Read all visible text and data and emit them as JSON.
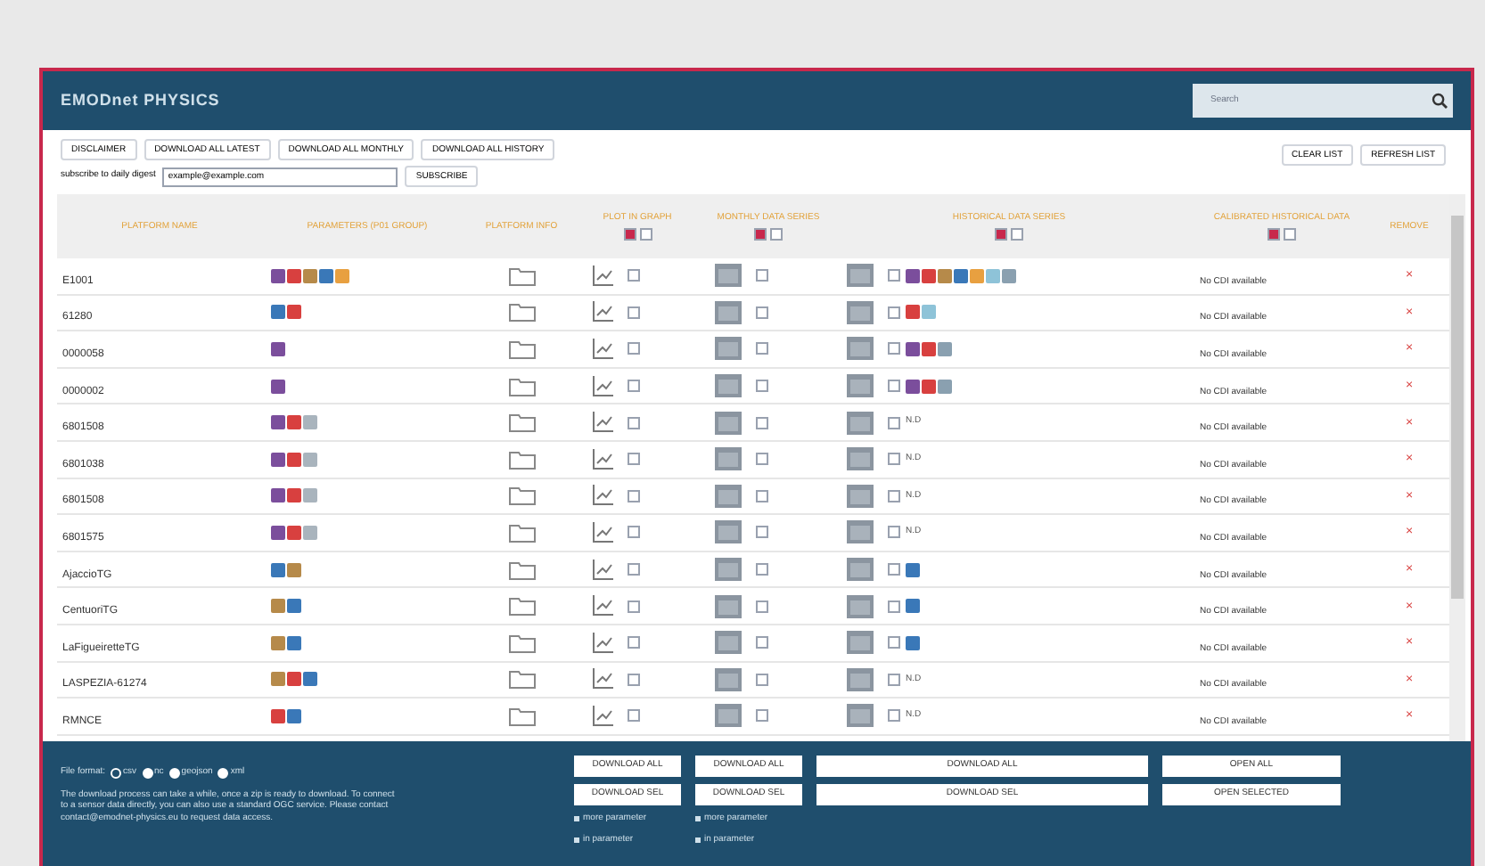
{
  "header": {
    "title": "EMODnet PHYSICS",
    "search": {
      "placeholder": "Search"
    }
  },
  "toolbar": {
    "buttons": [
      "DISCLAIMER",
      "DOWNLOAD ALL LATEST",
      "DOWNLOAD ALL MONTHLY",
      "DOWNLOAD ALL HISTORY"
    ],
    "right_buttons": [
      "CLEAR LIST",
      "REFRESH LIST"
    ],
    "subscribe": {
      "label": "subscribe to daily digest",
      "value": "example@example.com",
      "button": "SUBSCRIBE"
    }
  },
  "columns": [
    {
      "label": "PLATFORM NAME"
    },
    {
      "label": "PARAMETERS (P01 GROUP)"
    },
    {
      "label": "PLATFORM INFO"
    },
    {
      "label": "PLOT IN GRAPH",
      "toggles": [
        {
          "checked": true
        },
        {
          "checked": false
        }
      ]
    },
    {
      "label": "MONTHLY DATA SERIES",
      "toggles": [
        {
          "checked": true
        },
        {
          "checked": false
        }
      ]
    },
    {
      "label": "HISTORICAL DATA SERIES",
      "toggles": [
        {
          "checked": true
        },
        {
          "checked": false
        }
      ]
    },
    {
      "label": "CALIBRATED HISTORICAL DATA",
      "toggles": [
        {
          "checked": true
        },
        {
          "checked": false
        }
      ]
    },
    {
      "label": "REMOVE"
    }
  ],
  "rows": [
    {
      "name": "E1001",
      "parameters": [
        {
          "color": "#7b4e9c"
        },
        {
          "color": "#d8403f"
        },
        {
          "color": "#b68a4a"
        },
        {
          "color": "#3a78b8"
        },
        {
          "color": "#e8a040"
        }
      ],
      "plot_checked": false,
      "monthly_checked": false,
      "history": {
        "checked": false,
        "kind": "params",
        "parameters": [
          {
            "color": "#7b4e9c"
          },
          {
            "color": "#d8403f"
          },
          {
            "color": "#b68a4a"
          },
          {
            "color": "#3a78b8"
          },
          {
            "color": "#e8a040"
          },
          {
            "color": "#8ec3d8"
          },
          {
            "color": "#8aa0b0"
          }
        ]
      },
      "cdi": "No CDI available",
      "remove": "×"
    },
    {
      "name": "61280",
      "parameters": [
        {
          "color": "#3a78b8"
        },
        {
          "color": "#d8403f"
        }
      ],
      "plot_checked": false,
      "monthly_checked": false,
      "history": {
        "checked": false,
        "kind": "params",
        "parameters": [
          {
            "color": "#d8403f"
          },
          {
            "color": "#8ec3d8"
          }
        ]
      },
      "cdi": "No CDI available",
      "remove": "×"
    },
    {
      "name": "0000058",
      "parameters": [
        {
          "color": "#7b4e9c"
        }
      ],
      "plot_checked": false,
      "monthly_checked": false,
      "history": {
        "checked": false,
        "kind": "params",
        "parameters": [
          {
            "color": "#7b4e9c"
          },
          {
            "color": "#d8403f"
          },
          {
            "color": "#8aa0b0"
          }
        ]
      },
      "cdi": "No CDI available",
      "remove": "×"
    },
    {
      "name": "0000002",
      "parameters": [
        {
          "color": "#7b4e9c"
        }
      ],
      "plot_checked": false,
      "monthly_checked": false,
      "history": {
        "checked": false,
        "kind": "params",
        "parameters": [
          {
            "color": "#7b4e9c"
          },
          {
            "color": "#d8403f"
          },
          {
            "color": "#8aa0b0"
          }
        ]
      },
      "cdi": "No CDI available",
      "remove": "×"
    },
    {
      "name": "6801508",
      "parameters": [
        {
          "color": "#7b4e9c"
        },
        {
          "color": "#d8403f"
        },
        {
          "color": "#a9b4bd"
        }
      ],
      "plot_checked": false,
      "monthly_checked": false,
      "history": {
        "checked": false,
        "kind": "text",
        "text": "N.D"
      },
      "cdi": "No CDI available",
      "remove": "×"
    },
    {
      "name": "6801038",
      "parameters": [
        {
          "color": "#7b4e9c"
        },
        {
          "color": "#d8403f"
        },
        {
          "color": "#a9b4bd"
        }
      ],
      "plot_checked": false,
      "monthly_checked": false,
      "history": {
        "checked": false,
        "kind": "text",
        "text": "N.D"
      },
      "cdi": "No CDI available",
      "remove": "×"
    },
    {
      "name": "6801508",
      "parameters": [
        {
          "color": "#7b4e9c"
        },
        {
          "color": "#d8403f"
        },
        {
          "color": "#a9b4bd"
        }
      ],
      "plot_checked": false,
      "monthly_checked": false,
      "history": {
        "checked": false,
        "kind": "text",
        "text": "N.D"
      },
      "cdi": "No CDI available",
      "remove": "×"
    },
    {
      "name": "6801575",
      "parameters": [
        {
          "color": "#7b4e9c"
        },
        {
          "color": "#d8403f"
        },
        {
          "color": "#a9b4bd"
        }
      ],
      "plot_checked": false,
      "monthly_checked": false,
      "history": {
        "checked": false,
        "kind": "text",
        "text": "N.D"
      },
      "cdi": "No CDI available",
      "remove": "×"
    },
    {
      "name": "AjaccioTG",
      "parameters": [
        {
          "color": "#3a78b8"
        },
        {
          "color": "#b68a4a"
        }
      ],
      "plot_checked": false,
      "monthly_checked": false,
      "history": {
        "checked": false,
        "kind": "params",
        "parameters": [
          {
            "color": "#3a78b8"
          }
        ]
      },
      "cdi": "No CDI available",
      "remove": "×"
    },
    {
      "name": "CentuoriTG",
      "parameters": [
        {
          "color": "#b68a4a"
        },
        {
          "color": "#3a78b8"
        }
      ],
      "plot_checked": false,
      "monthly_checked": false,
      "history": {
        "checked": false,
        "kind": "params",
        "parameters": [
          {
            "color": "#3a78b8"
          }
        ]
      },
      "cdi": "No CDI available",
      "remove": "×"
    },
    {
      "name": "LaFigueiretteTG",
      "parameters": [
        {
          "color": "#b68a4a"
        },
        {
          "color": "#3a78b8"
        }
      ],
      "plot_checked": false,
      "monthly_checked": false,
      "history": {
        "checked": false,
        "kind": "params",
        "parameters": [
          {
            "color": "#3a78b8"
          }
        ]
      },
      "cdi": "No CDI available",
      "remove": "×"
    },
    {
      "name": "LASPEZIA-61274",
      "parameters": [
        {
          "color": "#b68a4a"
        },
        {
          "color": "#d8403f"
        },
        {
          "color": "#3a78b8"
        }
      ],
      "plot_checked": false,
      "monthly_checked": false,
      "history": {
        "checked": false,
        "kind": "text",
        "text": "N.D"
      },
      "cdi": "No CDI available",
      "remove": "×"
    },
    {
      "name": "RMNCE",
      "parameters": [
        {
          "color": "#d8403f"
        },
        {
          "color": "#3a78b8"
        }
      ],
      "plot_checked": false,
      "monthly_checked": false,
      "history": {
        "checked": false,
        "kind": "text",
        "text": "N.D"
      },
      "cdi": "No CDI available",
      "remove": "×"
    }
  ],
  "footer": {
    "format_label": "File format:",
    "formats": [
      {
        "label": "csv",
        "selected": false
      },
      {
        "label": "nc",
        "selected": true
      },
      {
        "label": "geojson",
        "selected": true
      },
      {
        "label": "xml",
        "selected": true
      }
    ],
    "note": "The download process can take a while, once a zip is ready to download. To connect to a sensor data directly, you can also use a standard OGC service. Please contact contact@emodnet-physics.eu to request data access.",
    "groups": [
      {
        "buttons": [
          "DOWNLOAD ALL",
          "DOWNLOAD SEL"
        ],
        "links": [
          "more parameter",
          "in parameter"
        ]
      },
      {
        "buttons": [
          "DOWNLOAD ALL",
          "DOWNLOAD SEL"
        ],
        "links": [
          "more parameter",
          "in parameter"
        ]
      },
      {
        "buttons": [
          "DOWNLOAD ALL",
          "DOWNLOAD SEL"
        ]
      },
      {
        "buttons": [
          "OPEN ALL",
          "OPEN SELECTED"
        ]
      }
    ]
  }
}
